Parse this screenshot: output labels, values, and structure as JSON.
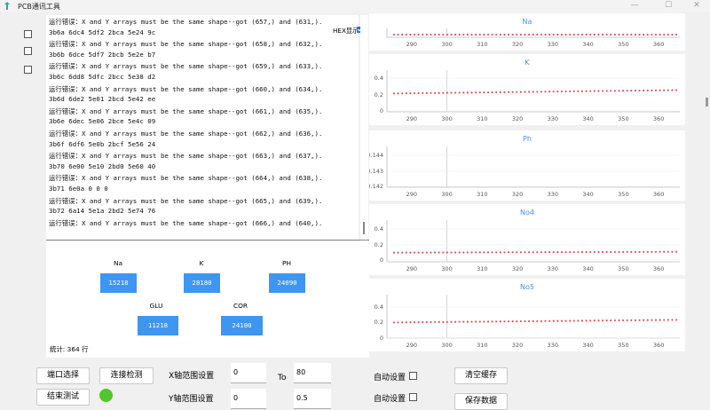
{
  "window": {
    "title": "PCB通讯工具"
  },
  "log": {
    "hex_label": "HEX显示",
    "lines": [
      "运行错误：X and Y arrays must be the same shape--got (657,) and (631,).",
      "3b6a 6dc4 5df2 2bca 5e24 9c",
      "运行错误：X and Y arrays must be the same shape--got (658,) and (632,).",
      "3b6b 6dce 5df7 2bcb 5e2e b7",
      "运行错误：X and Y arrays must be the same shape--got (659,) and (633,).",
      "3b6c 6dd8 5dfc 2bcc 5e38 d2",
      "运行错误：X and Y arrays must be the same shape--got (660,) and (634,).",
      "3b6d 6de2 5e01 2bcd 5e42 ee",
      "运行错误：X and Y arrays must be the same shape--got (661,) and (635,).",
      "3b6e 6dec 5e06 2bce 5e4c 09",
      "运行错误：X and Y arrays must be the same shape--got (662,) and (636,).",
      "3b6f 6df6 5e0b 2bcf 5e56 24",
      "运行错误：X and Y arrays must be the same shape--got (663,) and (637,).",
      "3b70 6e00 5e10 2bd0 5e60 40",
      "运行错误：X and Y arrays must be the same shape--got (664,) and (638,).",
      "3b71 6e0a 0 0 0",
      "运行错误：X and Y arrays must be the same shape--got (665,) and (639,).",
      "3b72 6a14 5e1a 2bd2 5e74 76",
      "运行错误：X and Y arrays must be the same shape--got (666,) and (640,)."
    ]
  },
  "values": {
    "na": {
      "label": "Na",
      "value": "15218"
    },
    "k": {
      "label": "K",
      "value": "28180"
    },
    "ph": {
      "label": "PH",
      "value": "24090"
    },
    "glu": {
      "label": "GLU",
      "value": "11218"
    },
    "cor": {
      "label": "COR",
      "value": "24180"
    }
  },
  "stats": {
    "label": "统计: 364 行"
  },
  "chart_data": [
    {
      "type": "scatter",
      "title": "Na",
      "x_ticks": [
        "290",
        "300",
        "310",
        "320",
        "330",
        "340",
        "350",
        "360"
      ],
      "y_ticks": [],
      "xlim": [
        283,
        366
      ],
      "series": [
        {
          "start": 285,
          "end": 365,
          "y_start": 0.5,
          "y_end": 0.5
        }
      ],
      "color": "#d9595f"
    },
    {
      "type": "scatter",
      "title": "K",
      "x_ticks": [
        "290",
        "300",
        "310",
        "320",
        "330",
        "340",
        "350",
        "360"
      ],
      "y_ticks": [
        "0.4",
        "0.2",
        "0"
      ],
      "xlim": [
        283,
        366
      ],
      "ylim": [
        0,
        0.5
      ],
      "series": [
        {
          "start": 285,
          "end": 365,
          "y_start": 0.22,
          "y_end": 0.26
        }
      ],
      "color": "#d9595f"
    },
    {
      "type": "scatter",
      "title": "Ph",
      "x_ticks": [
        "290",
        "300",
        "310",
        "320",
        "330",
        "340",
        "350",
        "360"
      ],
      "y_ticks": [
        "0.144",
        "0.143",
        "0.142"
      ],
      "xlim": [
        283,
        366
      ],
      "ylim": [
        0.1415,
        0.145
      ],
      "series": [],
      "color": "#d9595f"
    },
    {
      "type": "scatter",
      "title": "No4",
      "x_ticks": [
        "290",
        "300",
        "310",
        "320",
        "330",
        "340",
        "350",
        "360"
      ],
      "y_ticks": [
        "0.4",
        "0.2",
        "0"
      ],
      "xlim": [
        283,
        366
      ],
      "ylim": [
        0,
        0.5
      ],
      "series": [
        {
          "start": 285,
          "end": 365,
          "y_start": 0.11,
          "y_end": 0.12
        }
      ],
      "color": "#d9595f"
    },
    {
      "type": "scatter",
      "title": "No5",
      "x_ticks": [
        "290",
        "300",
        "310",
        "320",
        "330",
        "340",
        "350",
        "360"
      ],
      "y_ticks": [
        "0.4",
        "0.2",
        "0"
      ],
      "xlim": [
        283,
        366
      ],
      "ylim": [
        0,
        0.5
      ],
      "series": [
        {
          "start": 285,
          "end": 365,
          "y_start": 0.18,
          "y_end": 0.21
        }
      ],
      "color": "#d9595f"
    }
  ],
  "controls": {
    "port_select": "端口选择",
    "connect_test": "连接检测",
    "end_test": "结束测试",
    "x_range_label": "X轴范围设置",
    "y_range_label": "Y轴范围设置",
    "x_min": "0",
    "x_max": "80",
    "y_min": "0",
    "y_max": "0.5",
    "to_label": "To",
    "auto_set_1": "自动设置",
    "auto_set_2": "自动设置",
    "clear_cache": "清空缓存",
    "save_data": "保存数据"
  }
}
